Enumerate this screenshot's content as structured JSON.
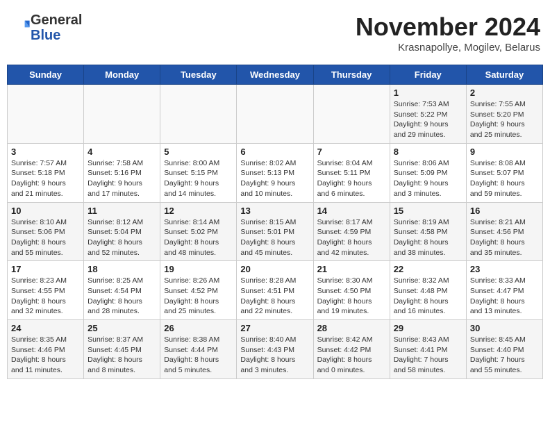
{
  "header": {
    "logo_line1": "General",
    "logo_line2": "Blue",
    "month_title": "November 2024",
    "subtitle": "Krasnapollye, Mogilev, Belarus"
  },
  "weekdays": [
    "Sunday",
    "Monday",
    "Tuesday",
    "Wednesday",
    "Thursday",
    "Friday",
    "Saturday"
  ],
  "weeks": [
    [
      {
        "day": "",
        "info": ""
      },
      {
        "day": "",
        "info": ""
      },
      {
        "day": "",
        "info": ""
      },
      {
        "day": "",
        "info": ""
      },
      {
        "day": "",
        "info": ""
      },
      {
        "day": "1",
        "info": "Sunrise: 7:53 AM\nSunset: 5:22 PM\nDaylight: 9 hours\nand 29 minutes."
      },
      {
        "day": "2",
        "info": "Sunrise: 7:55 AM\nSunset: 5:20 PM\nDaylight: 9 hours\nand 25 minutes."
      }
    ],
    [
      {
        "day": "3",
        "info": "Sunrise: 7:57 AM\nSunset: 5:18 PM\nDaylight: 9 hours\nand 21 minutes."
      },
      {
        "day": "4",
        "info": "Sunrise: 7:58 AM\nSunset: 5:16 PM\nDaylight: 9 hours\nand 17 minutes."
      },
      {
        "day": "5",
        "info": "Sunrise: 8:00 AM\nSunset: 5:15 PM\nDaylight: 9 hours\nand 14 minutes."
      },
      {
        "day": "6",
        "info": "Sunrise: 8:02 AM\nSunset: 5:13 PM\nDaylight: 9 hours\nand 10 minutes."
      },
      {
        "day": "7",
        "info": "Sunrise: 8:04 AM\nSunset: 5:11 PM\nDaylight: 9 hours\nand 6 minutes."
      },
      {
        "day": "8",
        "info": "Sunrise: 8:06 AM\nSunset: 5:09 PM\nDaylight: 9 hours\nand 3 minutes."
      },
      {
        "day": "9",
        "info": "Sunrise: 8:08 AM\nSunset: 5:07 PM\nDaylight: 8 hours\nand 59 minutes."
      }
    ],
    [
      {
        "day": "10",
        "info": "Sunrise: 8:10 AM\nSunset: 5:06 PM\nDaylight: 8 hours\nand 55 minutes."
      },
      {
        "day": "11",
        "info": "Sunrise: 8:12 AM\nSunset: 5:04 PM\nDaylight: 8 hours\nand 52 minutes."
      },
      {
        "day": "12",
        "info": "Sunrise: 8:14 AM\nSunset: 5:02 PM\nDaylight: 8 hours\nand 48 minutes."
      },
      {
        "day": "13",
        "info": "Sunrise: 8:15 AM\nSunset: 5:01 PM\nDaylight: 8 hours\nand 45 minutes."
      },
      {
        "day": "14",
        "info": "Sunrise: 8:17 AM\nSunset: 4:59 PM\nDaylight: 8 hours\nand 42 minutes."
      },
      {
        "day": "15",
        "info": "Sunrise: 8:19 AM\nSunset: 4:58 PM\nDaylight: 8 hours\nand 38 minutes."
      },
      {
        "day": "16",
        "info": "Sunrise: 8:21 AM\nSunset: 4:56 PM\nDaylight: 8 hours\nand 35 minutes."
      }
    ],
    [
      {
        "day": "17",
        "info": "Sunrise: 8:23 AM\nSunset: 4:55 PM\nDaylight: 8 hours\nand 32 minutes."
      },
      {
        "day": "18",
        "info": "Sunrise: 8:25 AM\nSunset: 4:54 PM\nDaylight: 8 hours\nand 28 minutes."
      },
      {
        "day": "19",
        "info": "Sunrise: 8:26 AM\nSunset: 4:52 PM\nDaylight: 8 hours\nand 25 minutes."
      },
      {
        "day": "20",
        "info": "Sunrise: 8:28 AM\nSunset: 4:51 PM\nDaylight: 8 hours\nand 22 minutes."
      },
      {
        "day": "21",
        "info": "Sunrise: 8:30 AM\nSunset: 4:50 PM\nDaylight: 8 hours\nand 19 minutes."
      },
      {
        "day": "22",
        "info": "Sunrise: 8:32 AM\nSunset: 4:48 PM\nDaylight: 8 hours\nand 16 minutes."
      },
      {
        "day": "23",
        "info": "Sunrise: 8:33 AM\nSunset: 4:47 PM\nDaylight: 8 hours\nand 13 minutes."
      }
    ],
    [
      {
        "day": "24",
        "info": "Sunrise: 8:35 AM\nSunset: 4:46 PM\nDaylight: 8 hours\nand 11 minutes."
      },
      {
        "day": "25",
        "info": "Sunrise: 8:37 AM\nSunset: 4:45 PM\nDaylight: 8 hours\nand 8 minutes."
      },
      {
        "day": "26",
        "info": "Sunrise: 8:38 AM\nSunset: 4:44 PM\nDaylight: 8 hours\nand 5 minutes."
      },
      {
        "day": "27",
        "info": "Sunrise: 8:40 AM\nSunset: 4:43 PM\nDaylight: 8 hours\nand 3 minutes."
      },
      {
        "day": "28",
        "info": "Sunrise: 8:42 AM\nSunset: 4:42 PM\nDaylight: 8 hours\nand 0 minutes."
      },
      {
        "day": "29",
        "info": "Sunrise: 8:43 AM\nSunset: 4:41 PM\nDaylight: 7 hours\nand 58 minutes."
      },
      {
        "day": "30",
        "info": "Sunrise: 8:45 AM\nSunset: 4:40 PM\nDaylight: 7 hours\nand 55 minutes."
      }
    ]
  ]
}
